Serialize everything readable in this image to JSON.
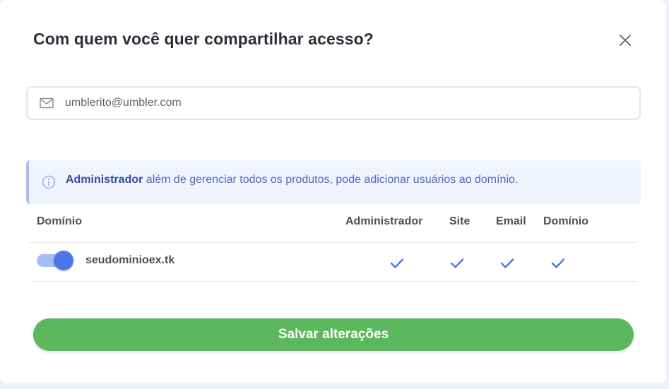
{
  "dialog": {
    "title": "Com quem você quer compartilhar acesso?",
    "close_icon": "close-icon"
  },
  "email_field": {
    "icon": "mail-icon",
    "value": "umblerito@umbler.com",
    "placeholder": ""
  },
  "info": {
    "icon": "info-icon",
    "role": "Administrador",
    "description": " além de gerenciar todos os produtos, pode adicionar usuários ao domínio."
  },
  "table": {
    "headers": {
      "domain": "Domínio",
      "admin": "Administrador",
      "site": "Site",
      "email": "Email",
      "dominio": "Domínio"
    },
    "rows": [
      {
        "enabled": true,
        "domain": "seudominioex.tk",
        "admin": true,
        "site": true,
        "email": true,
        "dominio": true
      }
    ]
  },
  "actions": {
    "save_label": "Salvar alterações"
  },
  "colors": {
    "accent": "#4c77ea",
    "save": "#5cb85c",
    "check": "#4c77ea"
  }
}
